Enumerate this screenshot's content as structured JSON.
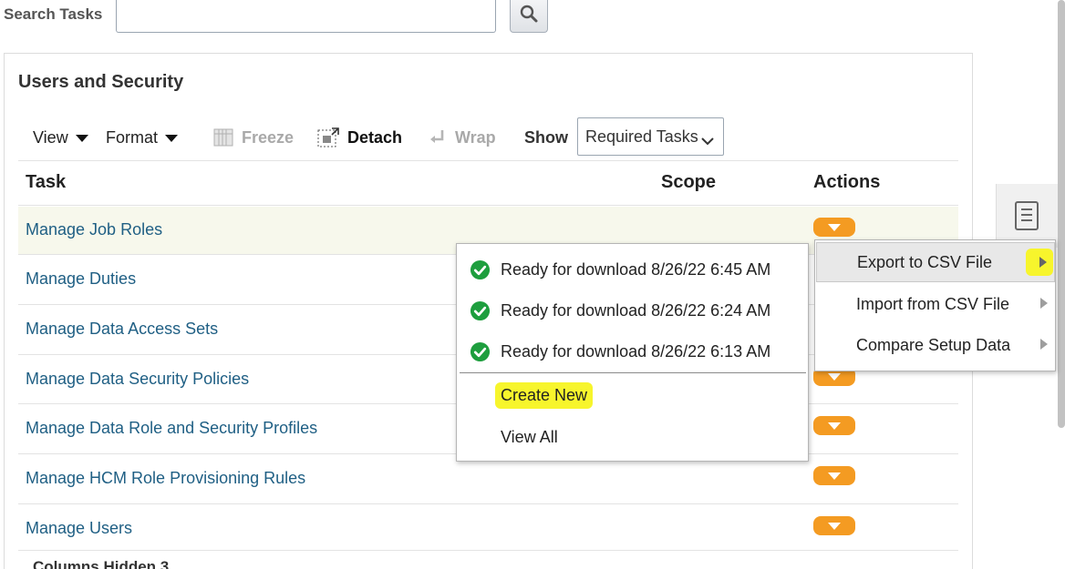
{
  "search": {
    "label": "Search Tasks",
    "value": "",
    "placeholder": ""
  },
  "panel": {
    "title": "Users and Security"
  },
  "toolbar": {
    "view_label": "View",
    "format_label": "Format",
    "freeze_label": "Freeze",
    "detach_label": "Detach",
    "wrap_label": "Wrap",
    "show_label": "Show",
    "show_selected": "Required Tasks"
  },
  "table": {
    "headers": {
      "task": "Task",
      "scope": "Scope",
      "actions": "Actions"
    },
    "rows": [
      {
        "task": "Manage Job Roles"
      },
      {
        "task": "Manage Duties"
      },
      {
        "task": "Manage Data Access Sets"
      },
      {
        "task": "Manage Data Security Policies"
      },
      {
        "task": "Manage Data Role and Security Profiles"
      },
      {
        "task": "Manage HCM Role Provisioning Rules"
      },
      {
        "task": "Manage Users"
      }
    ],
    "columns_hidden": "Columns Hidden 3"
  },
  "downloads_popup": {
    "items": [
      {
        "label": "Ready for download 8/26/22 6:45 AM"
      },
      {
        "label": "Ready for download 8/26/22 6:24 AM"
      },
      {
        "label": "Ready for download 8/26/22 6:13 AM"
      }
    ],
    "create_new": "Create New",
    "view_all": "View All"
  },
  "actions_menu": {
    "items": [
      {
        "label": "Export to CSV File"
      },
      {
        "label": "Import from CSV File"
      },
      {
        "label": "Compare Setup Data"
      }
    ]
  },
  "colors": {
    "accent_orange": "#f49b22",
    "link_blue": "#1f5f84",
    "highlight_yellow": "#f7f52c",
    "check_green": "#1e9e3e"
  },
  "icons": {
    "search": "magnifier-icon",
    "freeze": "freeze-columns-icon",
    "detach": "detach-icon",
    "wrap": "wrap-icon",
    "check": "check-circle-icon",
    "side_tab": "document-list-icon"
  }
}
